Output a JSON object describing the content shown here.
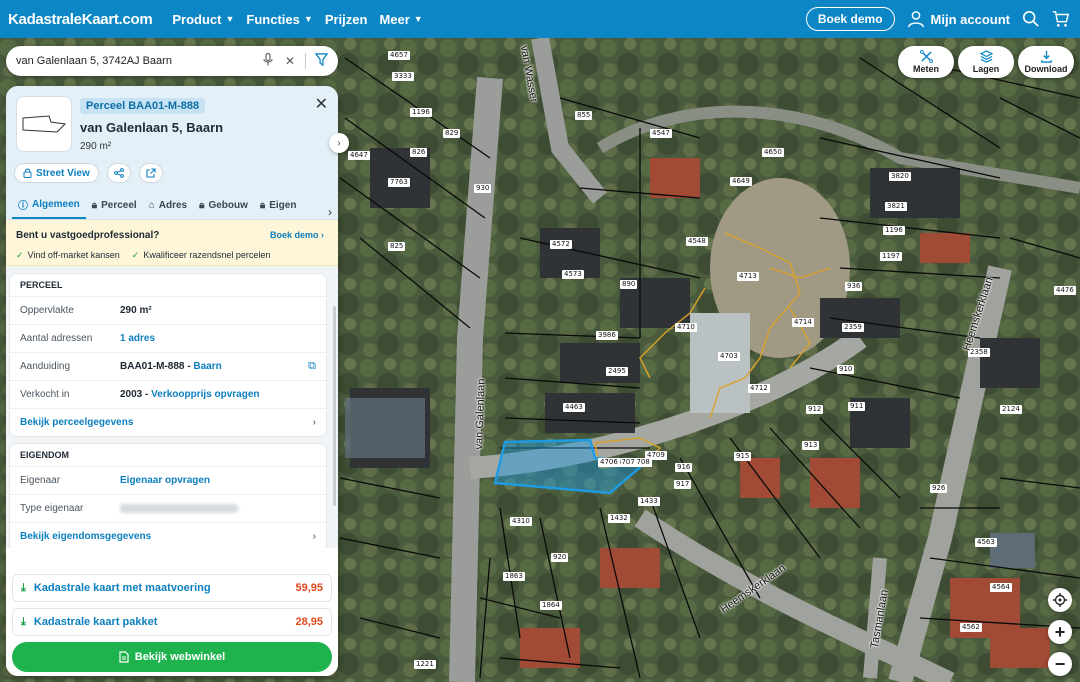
{
  "header": {
    "logo": "KadastraleKaart.com",
    "nav": [
      {
        "label": "Product",
        "dropdown": true
      },
      {
        "label": "Functies",
        "dropdown": true
      },
      {
        "label": "Prijzen",
        "dropdown": false
      },
      {
        "label": "Meer",
        "dropdown": true
      }
    ],
    "demo_button": "Boek demo",
    "account_label": "Mijn account"
  },
  "search": {
    "value": "van Galenlaan 5, 3742AJ Baarn"
  },
  "map_controls": {
    "measure": "Meten",
    "layers": "Lagen",
    "download": "Download",
    "zoom_in": "+",
    "zoom_out": "−"
  },
  "map_labels": {
    "parcels": [
      "4657",
      "3333",
      "855",
      "1196",
      "829",
      "826",
      "7763",
      "930",
      "825",
      "4647",
      "4572",
      "4573",
      "890",
      "4548",
      "4547",
      "4649",
      "4650",
      "4713",
      "4714",
      "4710",
      "4703",
      "4712",
      "3986",
      "2495",
      "4463",
      "4709",
      "4708",
      "4707",
      "4706",
      "916",
      "917",
      "915",
      "913",
      "912",
      "911",
      "910",
      "2359",
      "3820",
      "3821",
      "1196",
      "1197",
      "936",
      "4476",
      "2358",
      "2124",
      "920",
      "4310",
      "1432",
      "1433",
      "1863",
      "1864",
      "1221",
      "4563",
      "4564",
      "4562",
      "926"
    ],
    "streets": [
      "van Wasser",
      "van Galenlaan",
      "Heemskerklaan",
      "Heemskerklaan",
      "Tasmanlaan"
    ]
  },
  "panel": {
    "badge": "Perceel BAA01-M-888",
    "title": "van Galenlaan 5, Baarn",
    "area": "290 m²",
    "street_view": "Street View",
    "tabs": [
      "Algemeen",
      "Perceel",
      "Adres",
      "Gebouw",
      "Eigen"
    ],
    "promo": {
      "title": "Bent u vastgoedprofessional?",
      "link": "Boek demo ›",
      "points": [
        "Vind off-market kansen",
        "Kwalificeer razendsnel percelen"
      ]
    },
    "perceel": {
      "heading": "PERCEEL",
      "rows": [
        {
          "label": "Oppervlakte",
          "value": "290 m²"
        },
        {
          "label": "Aantal adressen",
          "value": "1 adres"
        },
        {
          "label": "Aanduiding",
          "value": "BAA01-M-888 - ",
          "link": "Baarn"
        },
        {
          "label": "Verkocht in",
          "value": "2003 - ",
          "link": "Verkoopprijs opvragen"
        }
      ],
      "more": "Bekijk perceelgegevens"
    },
    "eigendom": {
      "heading": "EIGENDOM",
      "rows": [
        {
          "label": "Eigenaar",
          "value": "Eigenaar opvragen"
        },
        {
          "label": "Type eigenaar",
          "value": ""
        }
      ],
      "more": "Bekijk eigendomsgegevens"
    },
    "shop": [
      {
        "label": "Kadastrale kaart met maatvoering",
        "price": "59,95"
      },
      {
        "label": "Kadastrale kaart pakket",
        "price": "28,95"
      }
    ],
    "shop_button": "Bekijk webwinkel"
  },
  "colors": {
    "brand": "#0d86c5",
    "link": "#0d7fbf",
    "price": "#e1491d",
    "cta": "#1fb34e",
    "parcel_highlight": "#1e9be0",
    "boundary": "#d9a22a"
  }
}
